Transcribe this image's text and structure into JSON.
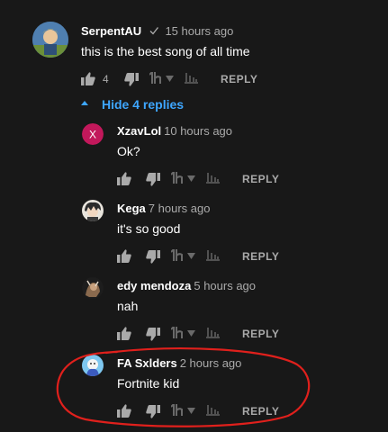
{
  "top_comment": {
    "author": "SerpentAU",
    "time": "15 hours ago",
    "text": "this is the best song of all time",
    "likes": "4",
    "reply_label": "REPLY"
  },
  "hide_replies_label": "Hide 4 replies",
  "replies": [
    {
      "author": "XzavLol",
      "time": "10 hours ago",
      "text": "Ok?",
      "avatar_letter": "X",
      "avatar_color": "#c2185b",
      "reply_label": "REPLY"
    },
    {
      "author": "Kega",
      "time": "7 hours ago",
      "text": "it's so good",
      "reply_label": "REPLY"
    },
    {
      "author": "edy mendoza",
      "time": "5 hours ago",
      "text": "nah",
      "reply_label": "REPLY"
    },
    {
      "author": "FA Sxlders",
      "time": "2 hours ago",
      "text": "Fortnite kid",
      "reply_label": "REPLY"
    }
  ],
  "annotation_color": "#e0201c"
}
